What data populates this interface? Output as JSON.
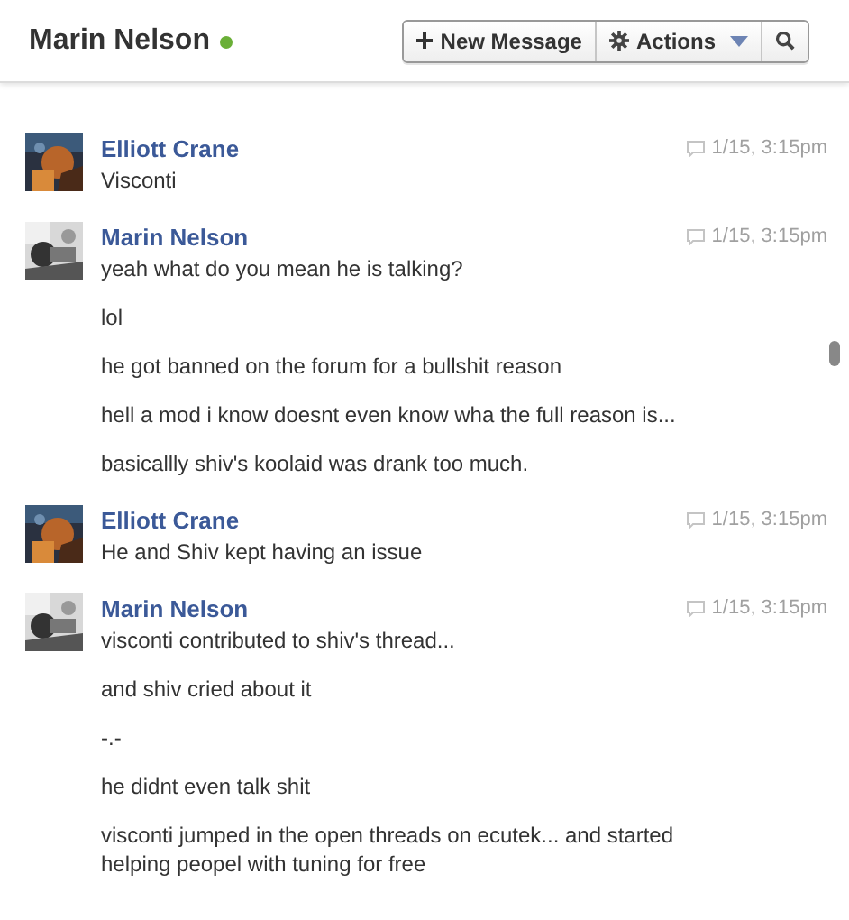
{
  "header": {
    "title": "Marin Nelson",
    "online": true,
    "buttons": [
      {
        "kind": "new",
        "label": "New Message"
      },
      {
        "kind": "actions",
        "label": "Actions"
      },
      {
        "kind": "search"
      }
    ]
  },
  "messages": [
    {
      "author": "Elliott Crane",
      "time": "1/15, 3:15pm",
      "lines": [
        "Visconti"
      ]
    },
    {
      "author": "Marin Nelson",
      "time": "1/15, 3:15pm",
      "lines": [
        "yeah what do you mean he is talking?",
        "lol",
        "he got banned on the forum for a bullshit reason",
        "hell a mod i know doesnt even know wha the full reason is...",
        "basicallly shiv's koolaid was drank too much."
      ]
    },
    {
      "author": "Elliott Crane",
      "time": "1/15, 3:15pm",
      "lines": [
        "He and Shiv kept having an issue"
      ]
    },
    {
      "author": "Marin Nelson",
      "time": "1/15, 3:15pm",
      "lines": [
        "visconti contributed to shiv's thread...",
        "and shiv cried about it",
        "-.-",
        "he didnt even talk shit",
        "visconti jumped in the open threads on ecutek... and started helping peopel with tuning for free"
      ]
    }
  ]
}
